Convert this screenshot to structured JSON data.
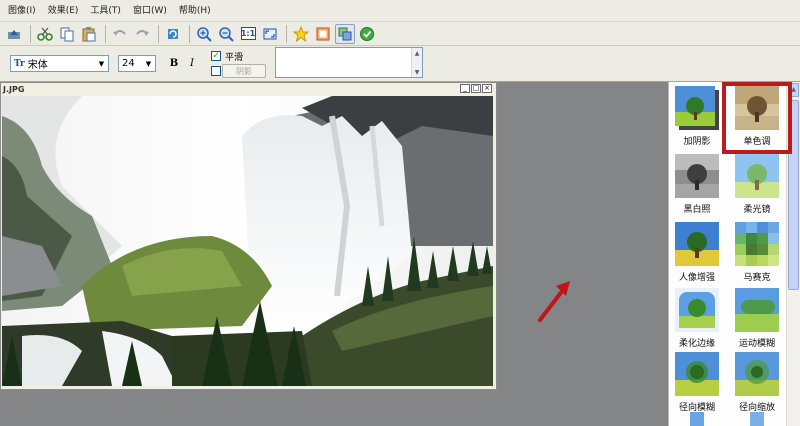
{
  "menu": {
    "items": [
      "图像(I)",
      "效果(E)",
      "工具(T)",
      "窗口(W)",
      "帮助(H)"
    ]
  },
  "fontbar": {
    "font_icon": "Tr",
    "font_name": "宋体",
    "font_size": "24",
    "bold": "B",
    "italic": "I",
    "smooth_label": "平滑",
    "smooth_checked": "✓",
    "shadow_label": "阴影"
  },
  "image_window": {
    "title": "J.JPG",
    "controls": [
      "_",
      "□",
      "×"
    ]
  },
  "effects": [
    {
      "label": "加阴影"
    },
    {
      "label": "单色调",
      "selected": true
    },
    {
      "label": "黑白照"
    },
    {
      "label": "柔光镜"
    },
    {
      "label": "人像增强"
    },
    {
      "label": "马赛克"
    },
    {
      "label": "柔化边缘"
    },
    {
      "label": "运动模糊"
    },
    {
      "label": "径向模糊"
    },
    {
      "label": "径向缩放"
    }
  ],
  "colors": {
    "selection_highlight": "#b81c1c",
    "annotation_arrow": "#c0161a"
  }
}
